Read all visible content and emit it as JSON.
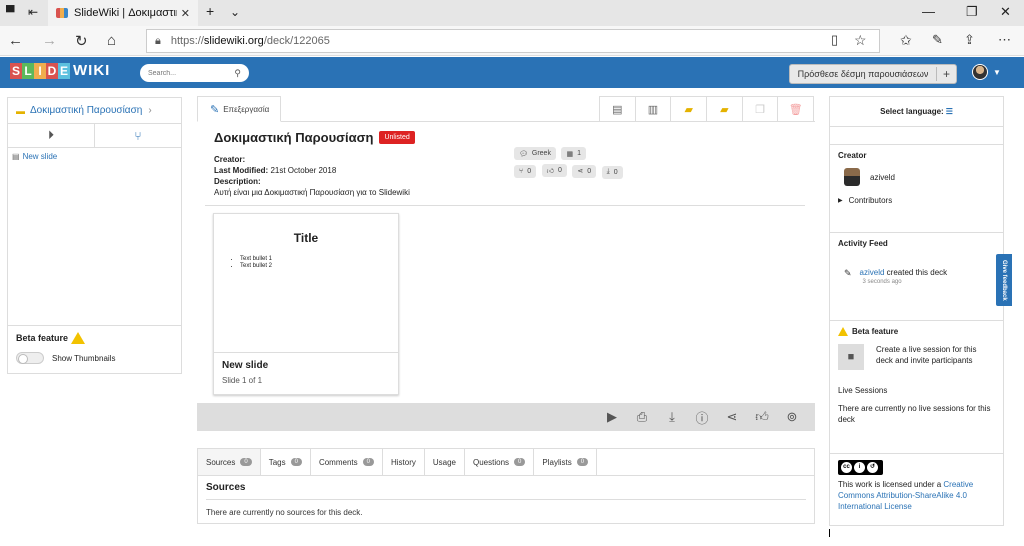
{
  "browser": {
    "tab_title": "SlideWiki | Δοκιμαστική",
    "url_prefix": "https://",
    "url_domain": "slidewiki.org",
    "url_path": "/deck/122065"
  },
  "site": {
    "logo_letters": [
      "S",
      "L",
      "I",
      "D",
      "E"
    ],
    "logo_suffix": "WIKI",
    "search_placeholder": "Search...",
    "add_deck_label": "Πρόσθεσε δέσμη παρουσιάσεων",
    "add_plus": "+"
  },
  "left": {
    "deck_name": "Δοκιμαστική Παρουσίαση",
    "slide_item": "New slide",
    "beta_label": "Beta feature",
    "thumbnails_label": "Show Thumbnails"
  },
  "center": {
    "edit_tab": "Επεξεργασία",
    "deck_title": "Δοκιμαστική Παρουσίαση",
    "unlisted": "Unlisted",
    "creator_label": "Creator:",
    "modified_label": "Last Modified:",
    "modified_value": "21st October 2018",
    "description_label": "Description:",
    "description_value": "Αυτή είναι μια Δοκιμαστική Παρουσίαση για το Slidewiki",
    "language_chip": "Greek",
    "slides_chip": "1",
    "forks": "0",
    "likes": "0",
    "shares": "0",
    "downloads": "0",
    "card": {
      "preview_title": "Title",
      "bullets": [
        "Text bullet 1",
        "Text bullet 2"
      ],
      "name": "New slide",
      "sub": "Slide 1 of 1"
    }
  },
  "bottom": {
    "tabs": [
      {
        "label": "Sources",
        "count": "0"
      },
      {
        "label": "Tags",
        "count": "0"
      },
      {
        "label": "Comments",
        "count": "0"
      },
      {
        "label": "History"
      },
      {
        "label": "Usage"
      },
      {
        "label": "Questions",
        "count": "0"
      },
      {
        "label": "Playlists",
        "count": "0"
      }
    ],
    "section_title": "Sources",
    "section_text": "There are currently no sources for this deck."
  },
  "right": {
    "select_language": "Select language:",
    "creator_heading": "Creator",
    "creator_name": "aziveld",
    "contributors": "Contributors",
    "activity_heading": "Activity Feed",
    "activity_user": "aziveld",
    "activity_text": " created this deck",
    "activity_time": "3 seconds ago",
    "beta_heading": "Beta feature",
    "live_text": "Create a live session for this deck and invite participants",
    "live_sessions_heading": "Live Sessions",
    "live_sessions_text": "There are currently no live sessions for this deck",
    "license_prefix": "This work is licensed under a ",
    "license_link": "Creative Commons Attribution-ShareAlike 4.0 International License"
  },
  "feedback_label": "Give feedback"
}
